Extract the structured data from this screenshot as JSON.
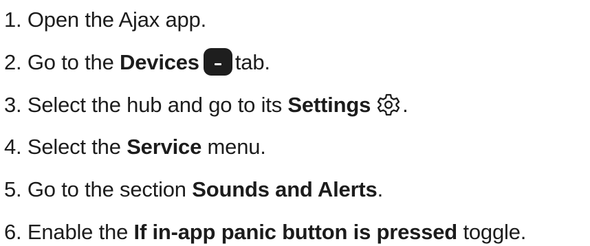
{
  "steps": [
    {
      "number": "1.",
      "text_before": "Open the Ajax app.",
      "bold": "",
      "text_after": ""
    },
    {
      "number": "2.",
      "text_before": "Go to the",
      "bold": "Devices",
      "icon": "devices-tab-icon",
      "text_after": "tab."
    },
    {
      "number": "3.",
      "text_before": "Select the hub and go to its",
      "bold": "Settings",
      "icon": "gear-icon",
      "text_after": "."
    },
    {
      "number": "4.",
      "text_before": "Select the",
      "bold": "Service",
      "text_after": "menu."
    },
    {
      "number": "5.",
      "text_before": "Go to the section",
      "bold": "Sounds and Alerts",
      "text_after": "."
    },
    {
      "number": "6.",
      "text_before": "Enable the",
      "bold": "If in-app panic button is pressed",
      "text_after": "toggle."
    }
  ]
}
